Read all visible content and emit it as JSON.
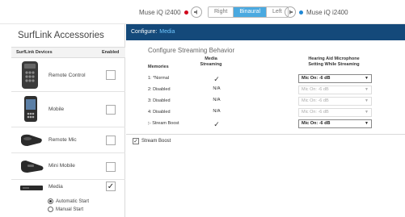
{
  "topbar": {
    "left_device": "Muse iQ i2400",
    "segments": [
      "Right",
      "Binaural",
      "Left"
    ],
    "right_device": "Muse iQ i2400"
  },
  "sidebar": {
    "title": "SurfLink Accessories",
    "col_devices": "SurfLink Devices",
    "col_enabled": "Enabled",
    "devices": [
      {
        "label": "Remote Control",
        "enabled": false,
        "icon": "remote-control-icon"
      },
      {
        "label": "Mobile",
        "enabled": false,
        "icon": "mobile-icon"
      },
      {
        "label": "Remote Mic",
        "enabled": false,
        "icon": "remote-mic-icon"
      },
      {
        "label": "Mini Mobile",
        "enabled": false,
        "icon": "mini-mobile-icon"
      },
      {
        "label": "Media",
        "enabled": true,
        "icon": "media-icon"
      }
    ],
    "start_options": [
      "Automatic Start",
      "Manual Start"
    ],
    "selected_start": "Automatic Start"
  },
  "main": {
    "header_label": "Configure:",
    "header_value": "Media",
    "section_title": "Configure Streaming Behavior",
    "col_memories": "Memories",
    "col_media_1": "Media",
    "col_media_2": "Streaming",
    "col_mic_1": "Hearing Aid Microphone",
    "col_mic_2": "Setting While Streaming",
    "rows": [
      {
        "memory": "1: *Normal",
        "streaming": "✓",
        "mic": "Mic On: -6 dB",
        "mic_enabled": true
      },
      {
        "memory": "2: Disabled",
        "streaming": "N/A",
        "mic": "Mic On: -6 dB",
        "mic_enabled": false
      },
      {
        "memory": "3: Disabled",
        "streaming": "N/A",
        "mic": "Mic On: -6 dB",
        "mic_enabled": false
      },
      {
        "memory": "4: Disabled",
        "streaming": "N/A",
        "mic": "Mic On: -6 dB",
        "mic_enabled": false
      },
      {
        "memory": "Stream Boost",
        "streaming": "✓",
        "mic": "Mic On: -6 dB",
        "mic_enabled": true
      }
    ],
    "stream_boost_label": "Stream Boost",
    "stream_boost_checked": true
  },
  "colors": {
    "header_bar": "#14497a",
    "header_value": "#6ec6ff",
    "binaural_active": "#4aa9e0",
    "left_dot": "#d0021b",
    "right_dot": "#1e87d4"
  }
}
